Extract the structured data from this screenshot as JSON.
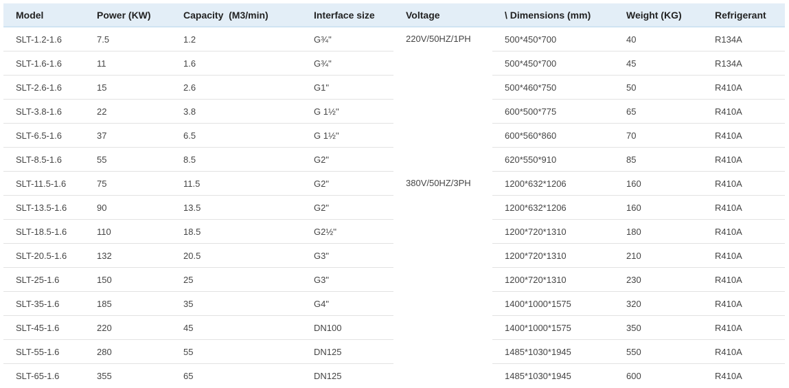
{
  "columns": [
    "Model",
    "Power (KW)",
    "Capacity  (M3/min)",
    "Interface size",
    "Voltage",
    "\\ Dimensions (mm)",
    "Weight (KG)",
    "Refrigerant"
  ],
  "voltage_groups": [
    {
      "label": "220V/50HZ/1PH",
      "rowspan": 6
    },
    {
      "label": "380V/50HZ/3PH",
      "rowspan": 9
    }
  ],
  "rows": [
    {
      "model": "SLT-1.2-1.6",
      "power": "7.5",
      "capacity": "1.2",
      "interface": "G¾''",
      "dimensions": "500*450*700",
      "weight": "40",
      "refrigerant": "R134A"
    },
    {
      "model": "SLT-1.6-1.6",
      "power": "11",
      "capacity": "1.6",
      "interface": "G¾''",
      "dimensions": "500*450*700",
      "weight": "45",
      "refrigerant": "R134A"
    },
    {
      "model": "SLT-2.6-1.6",
      "power": "15",
      "capacity": "2.6",
      "interface": "G1\"",
      "dimensions": "500*460*750",
      "weight": "50",
      "refrigerant": "R410A"
    },
    {
      "model": "SLT-3.8-1.6",
      "power": "22",
      "capacity": "3.8",
      "interface": "G 1½''",
      "dimensions": "600*500*775",
      "weight": "65",
      "refrigerant": "R410A"
    },
    {
      "model": "SLT-6.5-1.6",
      "power": "37",
      "capacity": "6.5",
      "interface": "G 1½''",
      "dimensions": "600*560*860",
      "weight": "70",
      "refrigerant": "R410A"
    },
    {
      "model": "SLT-8.5-1.6",
      "power": "55",
      "capacity": "8.5",
      "interface": "G2\"",
      "dimensions": "620*550*910",
      "weight": "85",
      "refrigerant": "R410A"
    },
    {
      "model": "SLT-11.5-1.6",
      "power": "75",
      "capacity": "11.5",
      "interface": "G2\"",
      "dimensions": "1200*632*1206",
      "weight": "160",
      "refrigerant": "R410A"
    },
    {
      "model": "SLT-13.5-1.6",
      "power": "90",
      "capacity": "13.5",
      "interface": "G2\"",
      "dimensions": "1200*632*1206",
      "weight": "160",
      "refrigerant": "R410A"
    },
    {
      "model": "SLT-18.5-1.6",
      "power": "110",
      "capacity": "18.5",
      "interface": "G2½''",
      "dimensions": "1200*720*1310",
      "weight": "180",
      "refrigerant": "R410A"
    },
    {
      "model": "SLT-20.5-1.6",
      "power": "132",
      "capacity": "20.5",
      "interface": "G3\"",
      "dimensions": "1200*720*1310",
      "weight": "210",
      "refrigerant": "R410A"
    },
    {
      "model": "SLT-25-1.6",
      "power": "150",
      "capacity": "25",
      "interface": "G3\"",
      "dimensions": "1200*720*1310",
      "weight": "230",
      "refrigerant": "R410A"
    },
    {
      "model": "SLT-35-1.6",
      "power": "185",
      "capacity": "35",
      "interface": "G4\"",
      "dimensions": "1400*1000*1575",
      "weight": "320",
      "refrigerant": "R410A"
    },
    {
      "model": "SLT-45-1.6",
      "power": "220",
      "capacity": "45",
      "interface": "DN100",
      "dimensions": "1400*1000*1575",
      "weight": "350",
      "refrigerant": "R410A"
    },
    {
      "model": "SLT-55-1.6",
      "power": "280",
      "capacity": "55",
      "interface": "DN125",
      "dimensions": "1485*1030*1945",
      "weight": "550",
      "refrigerant": "R410A"
    },
    {
      "model": "SLT-65-1.6",
      "power": "355",
      "capacity": "65",
      "interface": "DN125",
      "dimensions": "1485*1030*1945",
      "weight": "600",
      "refrigerant": "R410A"
    }
  ]
}
